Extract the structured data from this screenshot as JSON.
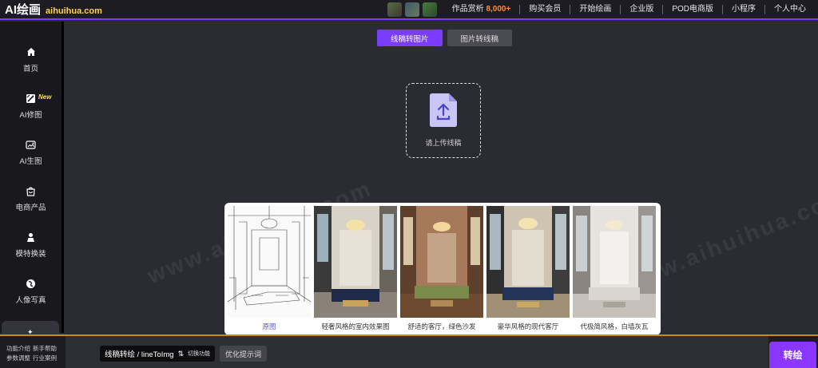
{
  "logo": {
    "main": "AI绘画",
    "domain": "aihuihua.com"
  },
  "topnav": {
    "gallery_label": "作品赏析",
    "gallery_count": "8,000+",
    "links": [
      "购买会员",
      "开始绘画",
      "企业版",
      "POD电商版",
      "小程序",
      "个人中心"
    ]
  },
  "sidebar": {
    "items": [
      {
        "label": "首页",
        "icon": "home-icon"
      },
      {
        "label": "AI修图",
        "icon": "magic-edit-icon",
        "badge": "New"
      },
      {
        "label": "AI生图",
        "icon": "image-generate-icon"
      },
      {
        "label": "电商产品",
        "icon": "shopping-bag-icon"
      },
      {
        "label": "模特换装",
        "icon": "model-icon"
      },
      {
        "label": "人像写真",
        "icon": "portrait-icon"
      }
    ]
  },
  "tabs": [
    {
      "label": "线稿转图片",
      "active": true
    },
    {
      "label": "图片转线稿",
      "active": false
    }
  ],
  "upload": {
    "label": "请上传线稿",
    "icon": "upload-file-icon"
  },
  "watermark": "www.aihuihua.com",
  "examples": [
    {
      "caption": "原图"
    },
    {
      "caption": "轻奢风格的室内效果图"
    },
    {
      "caption": "舒适的客厅，绿色沙发"
    },
    {
      "caption": "豪华风格的现代客厅"
    },
    {
      "caption": "代极简风格，白墙灰瓦"
    }
  ],
  "bottom": {
    "help_links": [
      "功能介绍",
      "新手帮助",
      "参数调整",
      "行业案例"
    ],
    "mode_label": "线稿转绘 / lineToImg",
    "mode_switch": "切换功能",
    "optimize_label": "优化提示词",
    "draw_button": "转绘"
  },
  "colors": {
    "accent": "#7a3cff",
    "background": "#2b2b33",
    "sidebar": "#18181d",
    "highlight": "#ff8a3d"
  }
}
